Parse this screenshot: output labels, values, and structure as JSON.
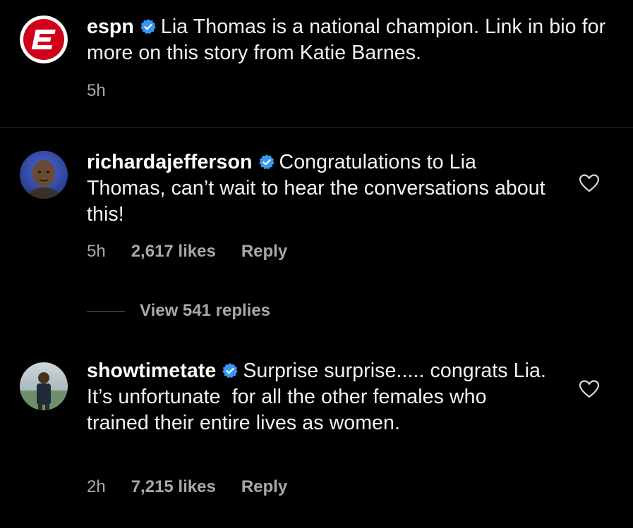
{
  "caption": {
    "username": "espn",
    "text": "Lia Thomas is a national champion. Link in bio for more on this story from Katie Barnes.",
    "time": "5h"
  },
  "comments": [
    {
      "username": "richardajefferson",
      "text": "Congratulations to Lia Thomas, can’t wait to hear the conversations about this!",
      "time": "5h",
      "likes": "2,617 likes",
      "reply_label": "Reply",
      "view_replies": "View 541 replies"
    },
    {
      "username": "showtimetate",
      "text": "Surprise surprise..... congrats Lia. It’s unfortunate  for all the other females who trained their entire lives as women.",
      "time": "2h",
      "likes": "7,215 likes",
      "reply_label": "Reply"
    }
  ],
  "colors": {
    "background": "#000000",
    "espn_red": "#d0021b",
    "verified_blue": "#3897f0",
    "meta_gray": "#a8a8a8"
  },
  "icons": {
    "verified": "verified-badge-icon",
    "like": "heart-outline-icon"
  }
}
